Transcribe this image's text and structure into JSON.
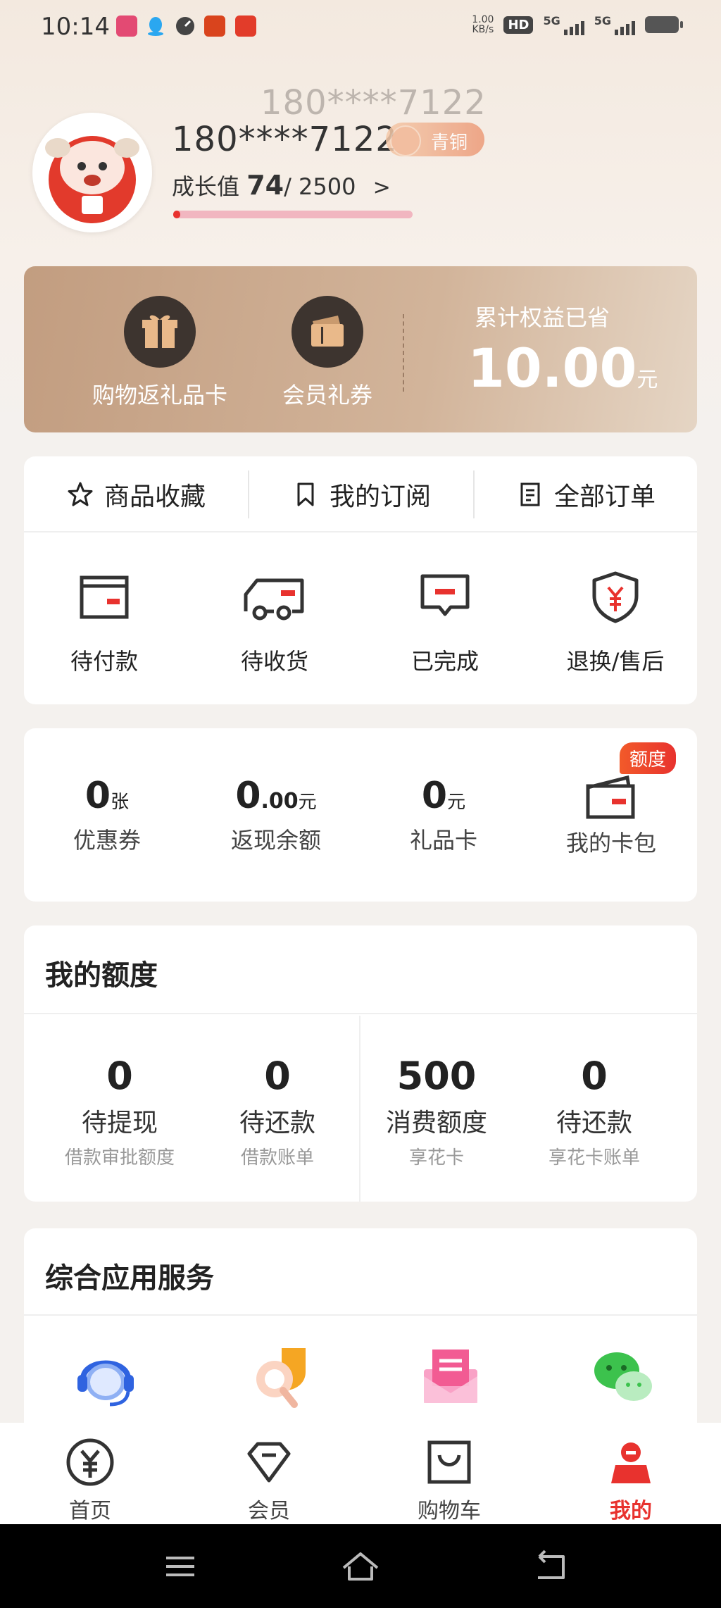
{
  "status_bar": {
    "time": "10:14",
    "net_speed_value": "1.00",
    "net_speed_unit": "KB/s",
    "hd_label": "HD",
    "signal1_label": "5G",
    "signal2_label": "5G"
  },
  "profile": {
    "phone_echo": "180****7122",
    "phone": "180****7122",
    "level_badge": "青铜",
    "growth_label": "成长值",
    "growth_value": "74",
    "growth_max": "/ 2500",
    "growth_chevron": ">",
    "growth_progress": 0.03
  },
  "benefits": {
    "items": [
      {
        "label": "购物返礼品卡",
        "icon": "gift-icon"
      },
      {
        "label": "会员礼券",
        "icon": "coupon-icon"
      }
    ],
    "saved_title": "累计权益已省",
    "saved_amount": "10.00",
    "saved_unit": "元"
  },
  "orders": {
    "tabs": [
      {
        "label": "商品收藏",
        "icon": "star-icon"
      },
      {
        "label": "我的订阅",
        "icon": "bookmark-icon"
      },
      {
        "label": "全部订单",
        "icon": "order-list-icon"
      }
    ],
    "statuses": [
      {
        "label": "待付款",
        "icon": "wallet-icon"
      },
      {
        "label": "待收货",
        "icon": "truck-icon"
      },
      {
        "label": "已完成",
        "icon": "message-icon"
      },
      {
        "label": "退换/售后",
        "icon": "shield-yen-icon"
      }
    ]
  },
  "assets": {
    "items": [
      {
        "value": "0",
        "unit": "张",
        "label": "优惠券"
      },
      {
        "value": "0",
        "decimals": ".00",
        "unit": "元",
        "label": "返现余额"
      },
      {
        "value": "0",
        "unit": "元",
        "label": "礼品卡"
      }
    ],
    "wallet_label": "我的卡包",
    "quota_tag": "额度"
  },
  "quota": {
    "title": "我的额度",
    "items": [
      {
        "value": "0",
        "label": "待提现",
        "sub": "借款审批额度"
      },
      {
        "value": "0",
        "label": "待还款",
        "sub": "借款账单"
      },
      {
        "value": "500",
        "label": "消费额度",
        "sub": "享花卡"
      },
      {
        "value": "0",
        "label": "待还款",
        "sub": "享花卡账单"
      }
    ]
  },
  "services": {
    "title": "综合应用服务",
    "icons": [
      "customer-service-icon",
      "search-app-icon",
      "mail-app-icon",
      "wechat-icon"
    ]
  },
  "bottom_nav": {
    "items": [
      {
        "label": "首页",
        "icon": "yen-home-icon"
      },
      {
        "label": "会员",
        "icon": "diamond-icon"
      },
      {
        "label": "购物车",
        "icon": "cart-icon"
      },
      {
        "label": "我的",
        "icon": "profile-icon",
        "active": true
      }
    ]
  },
  "colors": {
    "accent": "#e8322e",
    "benefit_bg": "#c29d80",
    "page_bg": "#f4f1ee"
  }
}
